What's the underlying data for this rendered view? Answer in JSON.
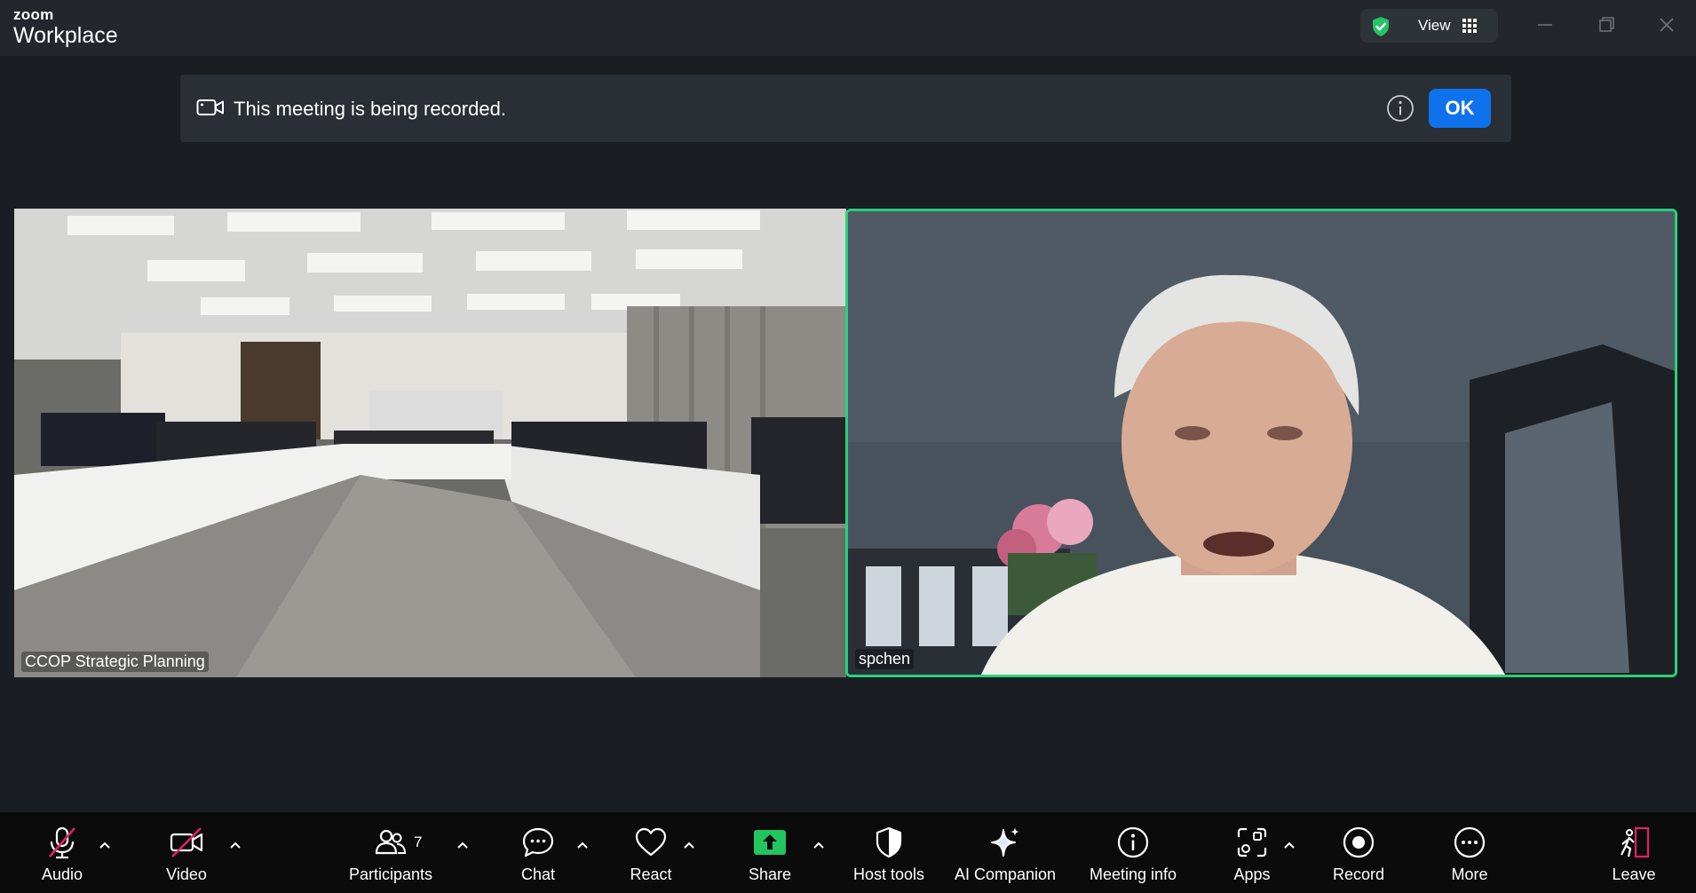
{
  "app": {
    "brand_small": "zoom",
    "brand_large": "Workplace"
  },
  "titlebar": {
    "view_label": "View",
    "accent": "#27c26a"
  },
  "banner": {
    "message": "This meeting is being recorded.",
    "ok_label": "OK",
    "ok_color": "#0e72ed"
  },
  "tiles": [
    {
      "name": "CCOP Strategic Planning",
      "active": false
    },
    {
      "name": "spchen",
      "active": true,
      "highlight_color": "#27d27a"
    }
  ],
  "toolbar": {
    "audio": "Audio",
    "video": "Video",
    "participants": "Participants",
    "participants_count": "7",
    "chat": "Chat",
    "react": "React",
    "share": "Share",
    "share_color": "#22c55e",
    "host_tools": "Host tools",
    "ai_companion": "AI Companion",
    "meeting_info": "Meeting info",
    "apps": "Apps",
    "record": "Record",
    "more": "More",
    "leave": "Leave",
    "muted_color": "#e0245e"
  }
}
